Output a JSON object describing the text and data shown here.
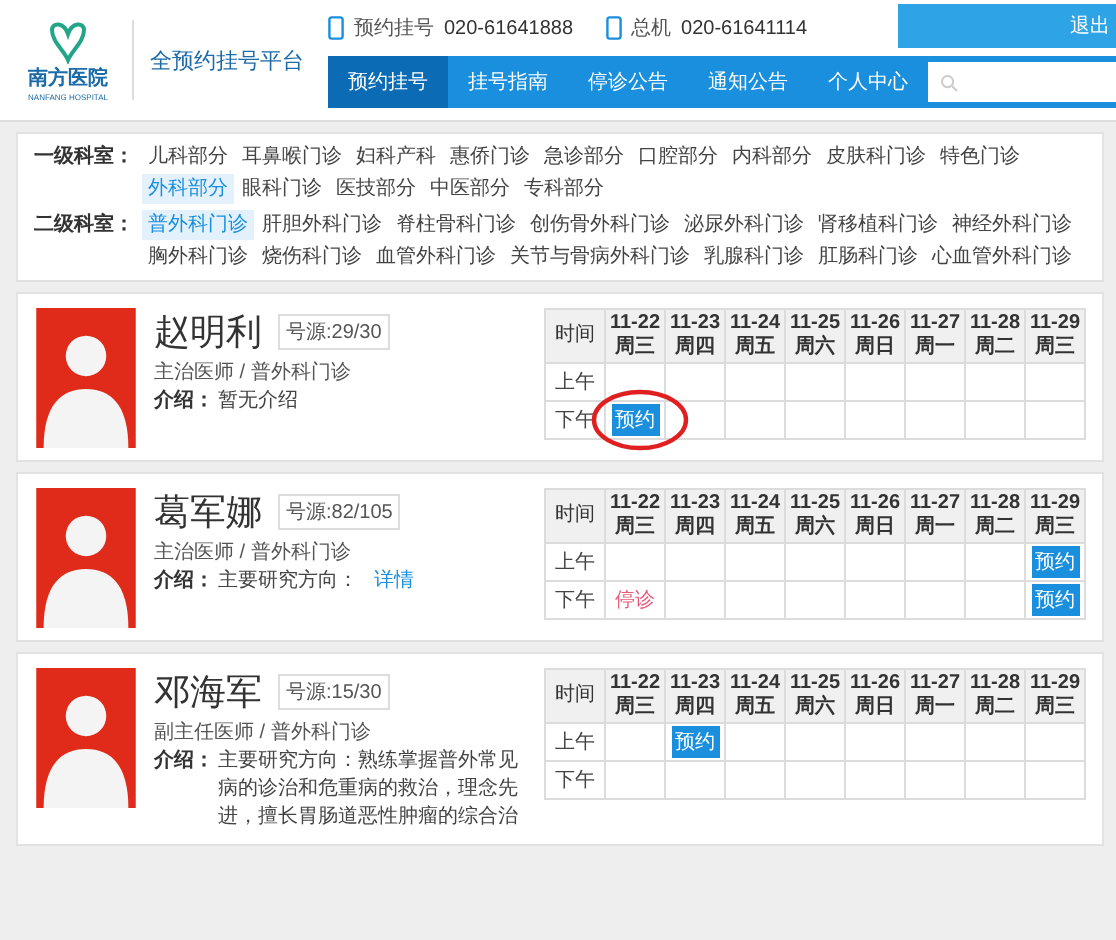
{
  "header": {
    "logo": {
      "name": "南方医院",
      "subtitle": "NANFANG HOSPITAL"
    },
    "platform": "全预约挂号平台",
    "phones": [
      {
        "label": "预约挂号",
        "number": "020-61641888"
      },
      {
        "label": "总机",
        "number": "020-61641114"
      }
    ],
    "logout": "退出",
    "nav": [
      {
        "label": "预约挂号",
        "selected": true
      },
      {
        "label": "挂号指南",
        "selected": false
      },
      {
        "label": "停诊公告",
        "selected": false
      },
      {
        "label": "通知公告",
        "selected": false
      },
      {
        "label": "个人中心",
        "selected": false
      }
    ]
  },
  "filters": [
    {
      "label": "一级科室：",
      "items": [
        {
          "text": "儿科部分",
          "selected": false
        },
        {
          "text": "耳鼻喉门诊",
          "selected": false
        },
        {
          "text": "妇科产科",
          "selected": false
        },
        {
          "text": "惠侨门诊",
          "selected": false
        },
        {
          "text": "急诊部分",
          "selected": false
        },
        {
          "text": "口腔部分",
          "selected": false
        },
        {
          "text": "内科部分",
          "selected": false
        },
        {
          "text": "皮肤科门诊",
          "selected": false
        },
        {
          "text": "特色门诊",
          "selected": false
        },
        {
          "text": "外科部分",
          "selected": true
        },
        {
          "text": "眼科门诊",
          "selected": false
        },
        {
          "text": "医技部分",
          "selected": false
        },
        {
          "text": "中医部分",
          "selected": false
        },
        {
          "text": "专科部分",
          "selected": false
        }
      ]
    },
    {
      "label": "二级科室：",
      "items": [
        {
          "text": "普外科门诊",
          "selected": true
        },
        {
          "text": "肝胆外科门诊",
          "selected": false
        },
        {
          "text": "脊柱骨科门诊",
          "selected": false
        },
        {
          "text": "创伤骨外科门诊",
          "selected": false
        },
        {
          "text": "泌尿外科门诊",
          "selected": false
        },
        {
          "text": "肾移植科门诊",
          "selected": false
        },
        {
          "text": "神经外科门诊",
          "selected": false
        },
        {
          "text": "胸外科门诊",
          "selected": false
        },
        {
          "text": "烧伤科门诊",
          "selected": false
        },
        {
          "text": "血管外科门诊",
          "selected": false
        },
        {
          "text": "关节与骨病外科门诊",
          "selected": false
        },
        {
          "text": "乳腺科门诊",
          "selected": false
        },
        {
          "text": "肛肠科门诊",
          "selected": false
        },
        {
          "text": "心血管外科门诊",
          "selected": false
        }
      ]
    }
  ],
  "doctors": [
    {
      "name": "赵明利",
      "quota": "号源:29/30",
      "title": "主治医师 / 普外科门诊",
      "intro_label": "介绍：",
      "intro": "暂无介绍",
      "schedule_header": {
        "time_label": "时间",
        "days": [
          {
            "date": "11-22",
            "weekday": "周三"
          },
          {
            "date": "11-23",
            "weekday": "周四"
          },
          {
            "date": "11-24",
            "weekday": "周五"
          },
          {
            "date": "11-25",
            "weekday": "周六"
          },
          {
            "date": "11-26",
            "weekday": "周日"
          },
          {
            "date": "11-27",
            "weekday": "周一"
          },
          {
            "date": "11-28",
            "weekday": "周二"
          },
          {
            "date": "11-29",
            "weekday": "周三"
          }
        ]
      },
      "rows": [
        {
          "label": "上午",
          "cells": [
            {
              "kind": "empty",
              "highlighted": false
            },
            {
              "kind": "empty",
              "highlighted": false
            },
            {
              "kind": "empty",
              "highlighted": false
            },
            {
              "kind": "empty",
              "highlighted": false
            },
            {
              "kind": "empty",
              "highlighted": false
            },
            {
              "kind": "empty",
              "highlighted": false
            },
            {
              "kind": "empty",
              "highlighted": false
            },
            {
              "kind": "empty",
              "highlighted": false
            }
          ]
        },
        {
          "label": "下午",
          "cells": [
            {
              "kind": "book",
              "text": "预约",
              "highlighted": true
            },
            {
              "kind": "empty",
              "highlighted": false
            },
            {
              "kind": "empty",
              "highlighted": false
            },
            {
              "kind": "empty",
              "highlighted": false
            },
            {
              "kind": "empty",
              "highlighted": false
            },
            {
              "kind": "empty",
              "highlighted": false
            },
            {
              "kind": "empty",
              "highlighted": false
            },
            {
              "kind": "empty",
              "highlighted": false
            }
          ]
        }
      ]
    },
    {
      "name": "葛军娜",
      "quota": "号源:82/105",
      "title": "主治医师 / 普外科门诊",
      "intro_label": "介绍：",
      "intro": "主要研究方向：",
      "link": "详情",
      "schedule_header": {
        "time_label": "时间",
        "days": [
          {
            "date": "11-22",
            "weekday": "周三"
          },
          {
            "date": "11-23",
            "weekday": "周四"
          },
          {
            "date": "11-24",
            "weekday": "周五"
          },
          {
            "date": "11-25",
            "weekday": "周六"
          },
          {
            "date": "11-26",
            "weekday": "周日"
          },
          {
            "date": "11-27",
            "weekday": "周一"
          },
          {
            "date": "11-28",
            "weekday": "周二"
          },
          {
            "date": "11-29",
            "weekday": "周三"
          }
        ]
      },
      "rows": [
        {
          "label": "上午",
          "cells": [
            {
              "kind": "empty",
              "highlighted": false
            },
            {
              "kind": "empty",
              "highlighted": false
            },
            {
              "kind": "empty",
              "highlighted": false
            },
            {
              "kind": "empty",
              "highlighted": false
            },
            {
              "kind": "empty",
              "highlighted": false
            },
            {
              "kind": "empty",
              "highlighted": false
            },
            {
              "kind": "empty",
              "highlighted": false
            },
            {
              "kind": "book",
              "text": "预约",
              "highlighted": false
            }
          ]
        },
        {
          "label": "下午",
          "cells": [
            {
              "kind": "stopped",
              "text": "停诊",
              "highlighted": false
            },
            {
              "kind": "empty",
              "highlighted": false
            },
            {
              "kind": "empty",
              "highlighted": false
            },
            {
              "kind": "empty",
              "highlighted": false
            },
            {
              "kind": "empty",
              "highlighted": false
            },
            {
              "kind": "empty",
              "highlighted": false
            },
            {
              "kind": "empty",
              "highlighted": false
            },
            {
              "kind": "book",
              "text": "预约",
              "highlighted": false
            }
          ]
        }
      ]
    },
    {
      "name": "邓海军",
      "quota": "号源:15/30",
      "title": "副主任医师 / 普外科门诊",
      "intro_label": "介绍：",
      "intro": "主要研究方向：熟练掌握普外常见病的诊治和危重病的救治，理念先进，擅长胃肠道恶性肿瘤的综合治",
      "schedule_header": {
        "time_label": "时间",
        "days": [
          {
            "date": "11-22",
            "weekday": "周三"
          },
          {
            "date": "11-23",
            "weekday": "周四"
          },
          {
            "date": "11-24",
            "weekday": "周五"
          },
          {
            "date": "11-25",
            "weekday": "周六"
          },
          {
            "date": "11-26",
            "weekday": "周日"
          },
          {
            "date": "11-27",
            "weekday": "周一"
          },
          {
            "date": "11-28",
            "weekday": "周二"
          },
          {
            "date": "11-29",
            "weekday": "周三"
          }
        ]
      },
      "rows": [
        {
          "label": "上午",
          "cells": [
            {
              "kind": "empty",
              "highlighted": false
            },
            {
              "kind": "book",
              "text": "预约",
              "highlighted": false
            },
            {
              "kind": "empty",
              "highlighted": false
            },
            {
              "kind": "empty",
              "highlighted": false
            },
            {
              "kind": "empty",
              "highlighted": false
            },
            {
              "kind": "empty",
              "highlighted": false
            },
            {
              "kind": "empty",
              "highlighted": false
            },
            {
              "kind": "empty",
              "highlighted": false
            }
          ]
        },
        {
          "label": "下午",
          "cells": [
            {
              "kind": "empty",
              "highlighted": false
            },
            {
              "kind": "empty",
              "highlighted": false
            },
            {
              "kind": "empty",
              "highlighted": false
            },
            {
              "kind": "empty",
              "highlighted": false
            },
            {
              "kind": "empty",
              "highlighted": false
            },
            {
              "kind": "empty",
              "highlighted": false
            },
            {
              "kind": "empty",
              "highlighted": false
            },
            {
              "kind": "empty",
              "highlighted": false
            }
          ]
        }
      ]
    }
  ]
}
